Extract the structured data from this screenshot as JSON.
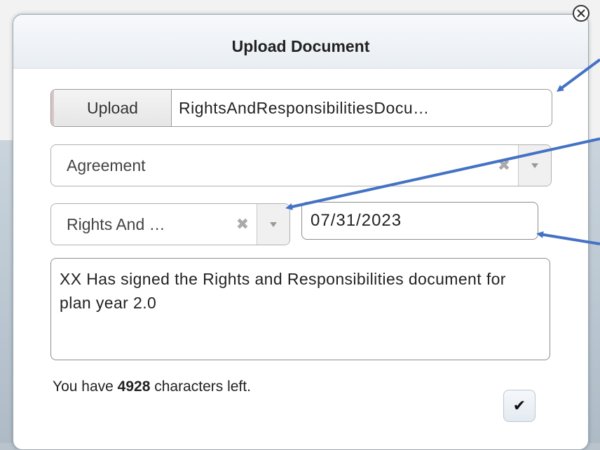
{
  "dialog": {
    "title": "Upload Document",
    "close_icon": "close-circle-x-icon"
  },
  "upload": {
    "button_label": "Upload",
    "file_name": "RightsAndResponsibilitiesDocu…"
  },
  "document_type": {
    "selected": "Agreement",
    "clear_icon": "clear-x-icon",
    "caret_icon": "caret-down-icon"
  },
  "document_subtype": {
    "selected": "Rights And …",
    "clear_icon": "clear-x-icon",
    "caret_icon": "caret-down-icon"
  },
  "date": {
    "value": "07/31/2023"
  },
  "notes": {
    "value": "XX Has signed the Rights and Responsibilities document for plan year 2.0"
  },
  "counter": {
    "prefix": "You have ",
    "count": "4928",
    "suffix": " characters left."
  },
  "submit": {
    "icon": "checkmark-icon",
    "glyph": "✔"
  },
  "colors": {
    "annotation_arrow": "#4472c4"
  }
}
